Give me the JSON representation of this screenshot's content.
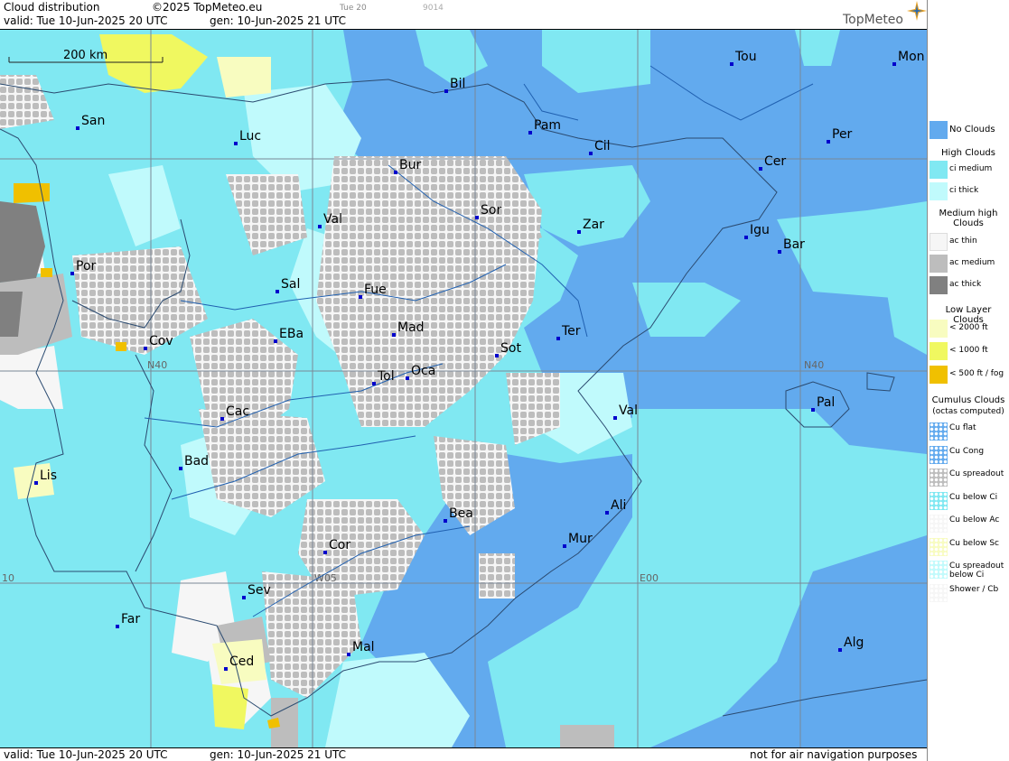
{
  "header": {
    "title": "Cloud distribution",
    "copyright": "©2025 TopMeteo.eu",
    "valid": "valid:  Tue  10-Jun-2025  20 UTC",
    "generated": "gen: 10-Jun-2025 21 UTC",
    "tag_day": "Tue 20",
    "tag_code": "9014",
    "brand": "TopMeteo"
  },
  "footer": {
    "valid": "valid:  Tue  10-Jun-2025  20 UTC",
    "generated": "gen: 10-Jun-2025 21 UTC",
    "disclaimer": "not for air navigation purposes"
  },
  "map": {
    "scale_label": "200 km",
    "grid_labels": [
      "N40",
      "N40",
      "W05",
      "E00",
      "10"
    ],
    "cities": [
      "Tou",
      "Mon",
      "Bil",
      "Pam",
      "Cil",
      "San",
      "Luc",
      "Bur",
      "Per",
      "Cer",
      "Sor",
      "Zar",
      "Val",
      "Igu",
      "Bar",
      "Por",
      "Sal",
      "Fue",
      "Mad",
      "Cov",
      "EBa",
      "Sot",
      "Ter",
      "Tol",
      "Oca",
      "Pal",
      "Cac",
      "Val",
      "Bad",
      "Lis",
      "Ali",
      "Bea",
      "Mur",
      "Cor",
      "Sev",
      "Far",
      "Mal",
      "Alg",
      "Ced"
    ]
  },
  "legend": {
    "no_clouds": "No Clouds",
    "high_title": "High Clouds",
    "high": [
      "ci medium",
      "ci thick"
    ],
    "medium_title": "Medium high Clouds",
    "medium": [
      "ac thin",
      "ac medium",
      "ac thick"
    ],
    "low_title": "Low Layer Clouds",
    "low": [
      "< 2000 ft",
      "< 1000 ft",
      "< 500 ft / fog"
    ],
    "cumulus_title": "Cumulus Clouds",
    "cumulus_sub": "(octas computed)",
    "cumulus": [
      "Cu flat",
      "Cu Cong",
      "Cu spreadout",
      "Cu below Ci",
      "Cu below Ac",
      "Cu below Sc",
      "Cu spreadout below Ci",
      "Shower / Cb"
    ]
  },
  "colors": {
    "no_clouds": "#62aaee",
    "ci_medium": "#80e8f2",
    "ci_thick": "#c0fafc",
    "ac_thin": "#f6f6f6",
    "ac_medium": "#bdbdbd",
    "ac_thick": "#808080",
    "low_2000": "#f8fcc0",
    "low_1000": "#f0f860",
    "low_500": "#f0c000"
  }
}
